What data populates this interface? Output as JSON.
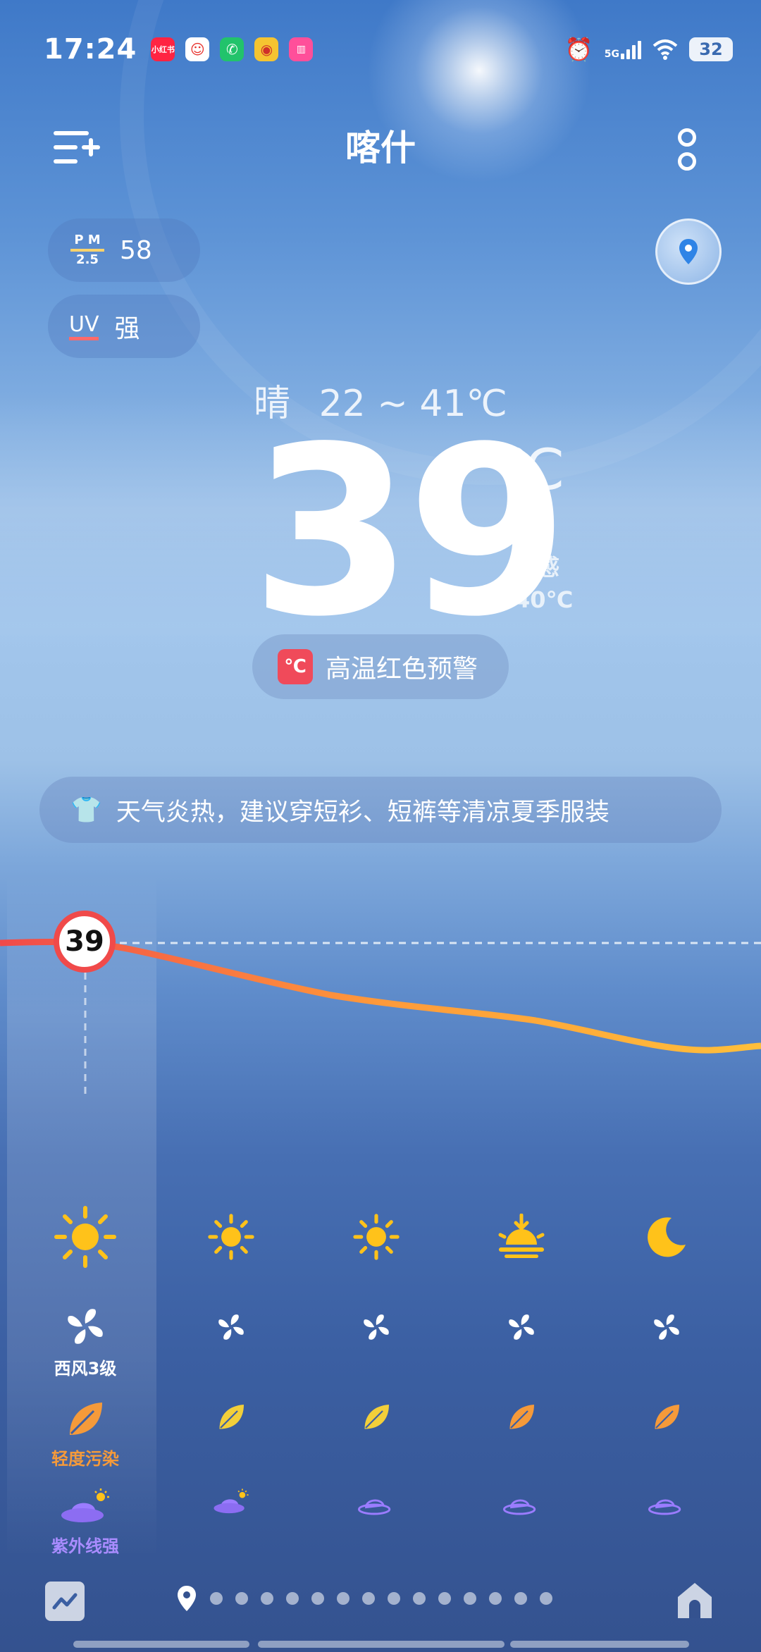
{
  "status_bar": {
    "time": "17:24",
    "apps": [
      {
        "name": "xiaohongshu-app",
        "text": "小红书",
        "color": "#ff2442"
      },
      {
        "name": "mascot-app",
        "text": "",
        "color": "#e8332e"
      },
      {
        "name": "phone-app",
        "text": "",
        "color": "#22c36b"
      },
      {
        "name": "weibo-app",
        "text": "",
        "color": "#f5a623"
      },
      {
        "name": "pink-app",
        "text": "",
        "color": "#ff4f9a"
      }
    ],
    "network": "5G",
    "battery": "32"
  },
  "header": {
    "city": "喀什"
  },
  "air": {
    "pm_top": "P M",
    "pm_bottom": "2.5",
    "pm_value": "58",
    "uv_label": "UV",
    "uv_value": "强"
  },
  "current": {
    "condition": "晴",
    "range": "22 ~ 41℃",
    "temp": "39",
    "unit": "℃",
    "feels_label": "体感",
    "feels_value": "40℃"
  },
  "alert": {
    "text": "高温红色预警",
    "color": "#f04a5a"
  },
  "tip": {
    "text": "天气炎热，建议穿短衫、短裤等清凉夏季服装"
  },
  "hourly": {
    "current_temp": "39",
    "wind_label": "西风3级",
    "air_label": "轻度污染",
    "uv_label": "紫外线强",
    "icons": [
      "sun-icon",
      "sun-icon",
      "sun-icon",
      "sunset-icon",
      "moon-icon"
    ]
  },
  "colors": {
    "sun": "#ffc21a",
    "curve_start": "#f04a4a",
    "curve_end": "#ffbf3b",
    "leaf_yellow": "#f2cf3a",
    "leaf_orange": "#f59a3a",
    "hat_purple": "#9b7cff"
  }
}
